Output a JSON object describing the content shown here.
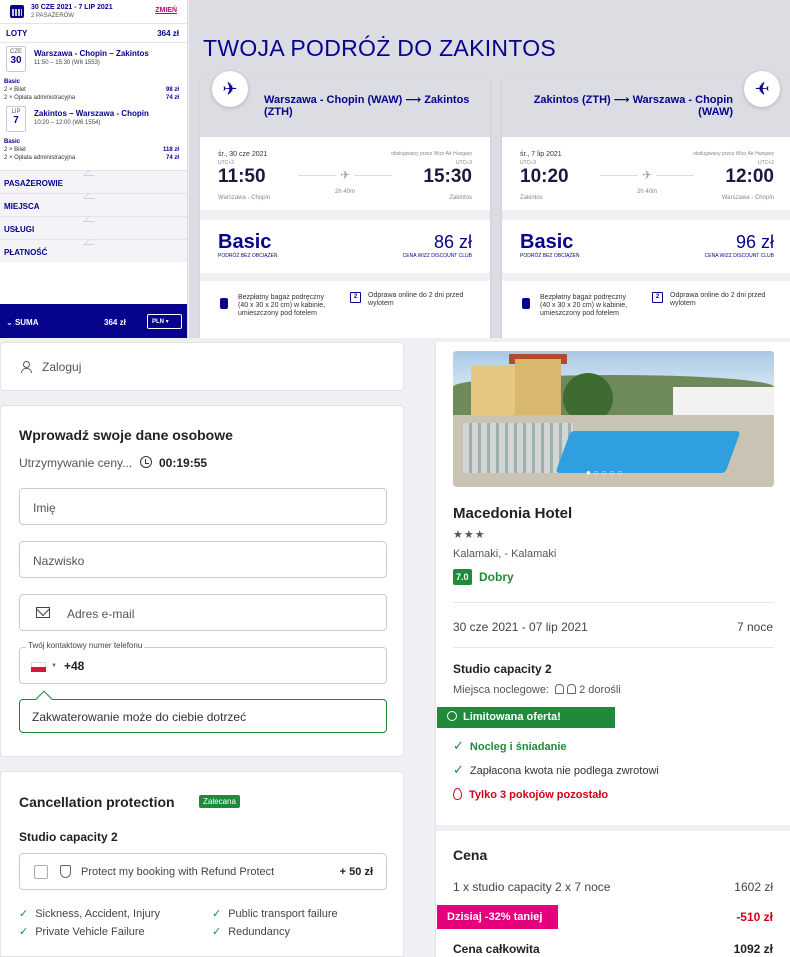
{
  "wizz": {
    "sidebar": {
      "dates": "30 CZE 2021 - 7 LIP 2021",
      "passengers": "2 PASAŻERÓW",
      "change": "ZMIEŃ",
      "flights_label": "LOTY",
      "flights_total": "364 zł",
      "flight1": {
        "month": "CZE",
        "day": "30",
        "route": "Warszawa - Chopin – Zakintos",
        "time": "11:50 – 15:30 (W6 1553)"
      },
      "fares1": [
        {
          "label": "Basic",
          "value": ""
        },
        {
          "label": "2 × Bilet",
          "value": "98 zł"
        },
        {
          "label": "2 × Opłata administracyjna",
          "value": "74 zł"
        }
      ],
      "flight2": {
        "month": "LIP",
        "day": "7",
        "route": "Zakintos – Warszawa - Chopin",
        "time": "10:20 – 12:00 (W6 1554)"
      },
      "fares2": [
        {
          "label": "Basic",
          "value": ""
        },
        {
          "label": "2 × Bilet",
          "value": "118 zł"
        },
        {
          "label": "2 × Opłata administracyjna",
          "value": "74 zł"
        }
      ],
      "sections": [
        "PASAŻEROWIE",
        "MIEJSCA",
        "USŁUGI",
        "PŁATNOŚĆ"
      ],
      "sum_label": "SUMA",
      "sum_value": "364 zł",
      "currency": "PLN"
    },
    "title": "TWOJA PODRÓŻ DO ZAKINTOS",
    "cards": [
      {
        "route": "Warszawa - Chopin (WAW) ⟶ Zakintos (ZTH)",
        "date": "śr., 30 cze 2021",
        "operated": "obsługiwany przez Wizz Air Hungary",
        "dep_utc": "UTC+2",
        "arr_utc": "UTC+3",
        "dep_time": "11:50",
        "arr_time": "15:30",
        "duration": "2h 40m",
        "dep_city": "Warszawa - Chopin",
        "arr_city": "Zakintos",
        "fare": "Basic",
        "fare_sub": "PODRÓŻ BEZ OBCIĄŻEŃ",
        "price": "86 zł",
        "price_sub": "CENA WIZZ DISCOUNT CLUB",
        "bag": "Bezpłatny bagaż podręczny (40 x 30 x 20 cm) w kabinie, umieszczony pod fotelem",
        "checkin": "Odprawa online do 2 dni przed wylotem"
      },
      {
        "route": "Zakintos (ZTH) ⟶ Warszawa - Chopin (WAW)",
        "date": "śr., 7 lip 2021",
        "operated": "obsługiwany przez Wizz Air Hungary",
        "dep_utc": "UTC+3",
        "arr_utc": "UTC+2",
        "dep_time": "10:20",
        "arr_time": "12:00",
        "duration": "2h 40m",
        "dep_city": "Zakintos",
        "arr_city": "Warszawa - Chopin",
        "fare": "Basic",
        "fare_sub": "PODRÓŻ BEZ OBCIĄŻEŃ",
        "price": "96 zł",
        "price_sub": "CENA WIZZ DISCOUNT CLUB",
        "bag": "Bezpłatny bagaż podręczny (40 x 30 x 20 cm) w kabinie, umieszczony pod fotelem",
        "checkin": "Odprawa online do 2 dni przed wylotem"
      }
    ]
  },
  "login": {
    "label": "Zaloguj"
  },
  "form": {
    "title": "Wprowadź swoje dane osobowe",
    "holding": "Utrzymywanie ceny...",
    "timer": "00:19:55",
    "first_name_placeholder": "Imię",
    "last_name_placeholder": "Nazwisko",
    "email_placeholder": "Adres e-mail",
    "phone_label": "Twój kontaktowy numer telefonu",
    "dial_code": "+48",
    "tip": "Zakwaterowanie może do ciebie dotrzeć"
  },
  "cancellation": {
    "title": "Cancellation protection",
    "badge": "Zalecana",
    "room": "Studio capacity 2",
    "option": "Protect my booking with Refund Protect",
    "price": "+ 50 zł",
    "features": [
      "Sickness, Accident, Injury",
      "Public transport failure",
      "Private Vehicle Failure",
      "Redundancy"
    ]
  },
  "hotel": {
    "name": "Macedonia Hotel",
    "stars": "★★★",
    "location": "Kalamaki, - Kalamaki",
    "rating": "7.0",
    "rating_text": "Dobry",
    "dates": "30 cze 2021 - 07 lip 2021",
    "nights": "7 noce",
    "room": "Studio capacity 2",
    "beds_label": "Miejsca noclegowe:",
    "beds_value": "2 dorośli",
    "limited": "Limitowana oferta!",
    "board": "Nocleg i śniadanie",
    "nonrefund": "Zapłacona kwota nie podlega zwrotowi",
    "rooms_left": "Tylko 3 pokojów pozostało",
    "price_title": "Cena",
    "line_label": "1 x studio capacity 2 x 7 noce",
    "line_value": "1602 zł",
    "discount_label": "Dzisiaj -32% taniej",
    "discount_value": "-510 zł",
    "total_label": "Cena całkowita",
    "total_value": "1092 zł"
  }
}
